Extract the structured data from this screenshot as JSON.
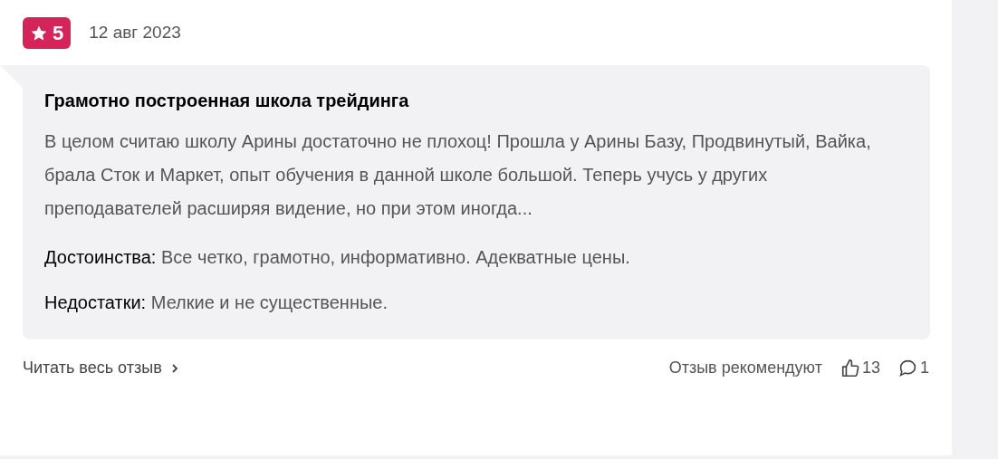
{
  "review": {
    "rating": "5",
    "date": "12 авг 2023",
    "title": "Грамотно построенная школа трейдинга",
    "body": "В целом считаю школу Арины достаточно не плохоц! Прошла у Арины Базу, Продвинутый, Вайка, брала Сток и Маркет, опыт обучения в данной школе большой. Теперь учусь у других преподавателей расширяя видение, но при этом иногда...",
    "sections": [
      {
        "label": "Достоинства:",
        "text": "Все четко, грамотно, информативно. Адекватные цены."
      },
      {
        "label": "Недостатки:",
        "text": "Мелкие и не существенные."
      }
    ],
    "read_more": "Читать весь отзыв",
    "recommend_label": "Отзыв рекомендуют",
    "likes": "13",
    "comments": "1"
  }
}
